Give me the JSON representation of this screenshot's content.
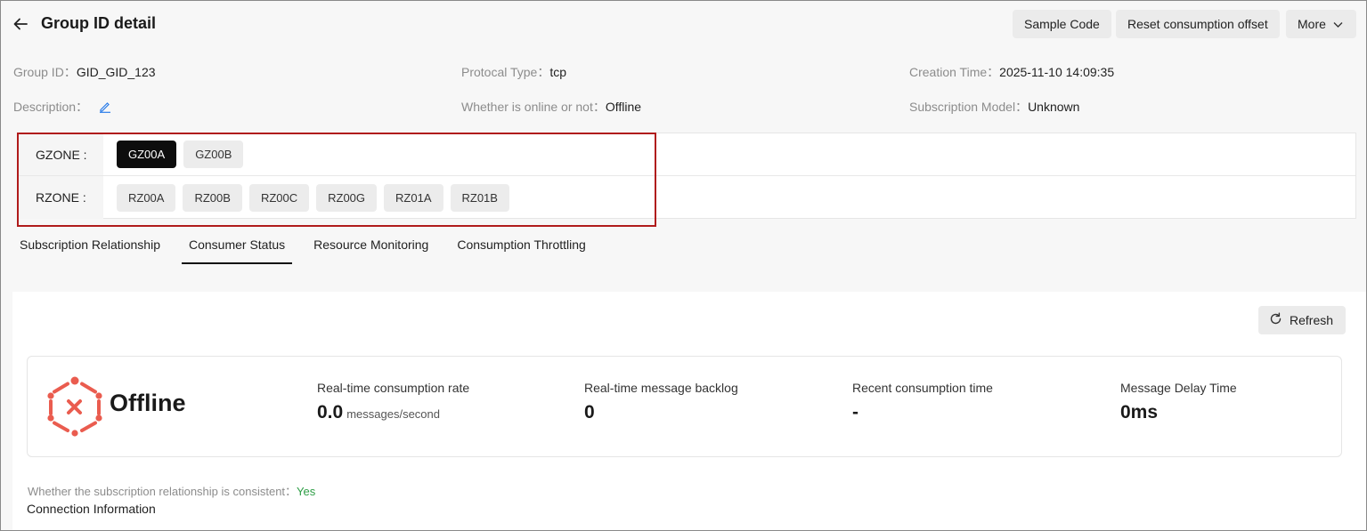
{
  "header": {
    "title": "Group ID detail",
    "buttons": {
      "sample_code": "Sample Code",
      "reset_offset": "Reset consumption offset",
      "more": "More"
    }
  },
  "info": {
    "group_id": {
      "label": "Group ID：",
      "value": "GID_GID_123"
    },
    "protocol": {
      "label": "Protocal Type：",
      "value": "tcp"
    },
    "creation": {
      "label": "Creation Time：",
      "value": "2025-11-10 14:09:35"
    },
    "description": {
      "label": "Description："
    },
    "online": {
      "label": "Whether is online or not：",
      "value": "Offline"
    },
    "subscription_model": {
      "label": "Subscription Model：",
      "value": "Unknown"
    }
  },
  "zones": {
    "gzone": {
      "label": "GZONE :",
      "items": [
        "GZ00A",
        "GZ00B"
      ],
      "selected": "GZ00A"
    },
    "rzone": {
      "label": "RZONE :",
      "items": [
        "RZ00A",
        "RZ00B",
        "RZ00C",
        "RZ00G",
        "RZ01A",
        "RZ01B"
      ]
    }
  },
  "tabs": [
    {
      "label": "Subscription Relationship",
      "active": false
    },
    {
      "label": "Consumer Status",
      "active": true
    },
    {
      "label": "Resource Monitoring",
      "active": false
    },
    {
      "label": "Consumption Throttling",
      "active": false
    }
  ],
  "panel": {
    "refresh_label": "Refresh",
    "status": "Offline",
    "metrics": [
      {
        "label": "Real-time consumption rate",
        "value": "0.0",
        "unit": "messages/second"
      },
      {
        "label": "Real-time message backlog",
        "value": "0",
        "unit": ""
      },
      {
        "label": "Recent consumption time",
        "value": "-",
        "unit": ""
      },
      {
        "label": "Message Delay Time",
        "value": "0ms",
        "unit": ""
      }
    ],
    "consistent_label": "Whether the subscription relationship is consistent：",
    "consistent_value": "Yes",
    "connection_info": "Connection Information"
  },
  "colors": {
    "accent_dark": "#0d0d0d",
    "highlight_border": "#b01b1b",
    "offline_icon": "#ea5c4f",
    "yes_green": "#2e9e46",
    "edit_icon_blue": "#2b7de9"
  }
}
